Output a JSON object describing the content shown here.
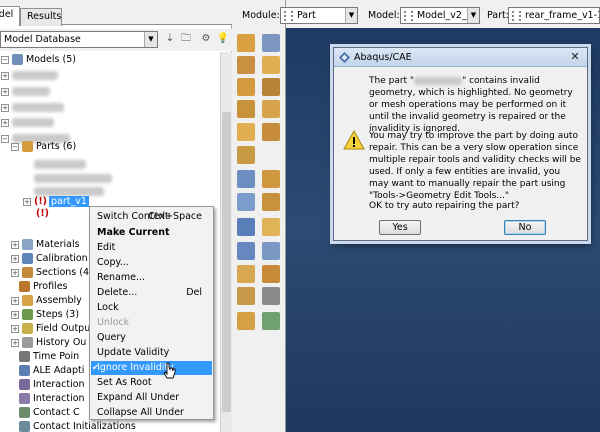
{
  "tabs": {
    "model": "odel",
    "results": "Results"
  },
  "db": {
    "label": "Model Database"
  },
  "tree": {
    "models": "Models (5)",
    "parts": "Parts (6)",
    "part_selected": "part_v1",
    "warn_mark": "(!)",
    "items": [
      {
        "label": "Materials"
      },
      {
        "label": "Calibration"
      },
      {
        "label": "Sections (4"
      },
      {
        "label": "Profiles"
      },
      {
        "label": "Assembly"
      },
      {
        "label": "Steps (3)"
      },
      {
        "label": "Field Outpu"
      },
      {
        "label": "History Ou"
      },
      {
        "label": "Time Poin"
      },
      {
        "label": "ALE Adapti"
      },
      {
        "label": "Interaction"
      },
      {
        "label": "Interaction"
      },
      {
        "label": "Contact C"
      },
      {
        "label": "Contact Initializations"
      }
    ]
  },
  "context": {
    "module_label": "Module:",
    "module_value": "Part",
    "model_label": "Model:",
    "model_value": "Model_v2_2",
    "part_label": "Part:",
    "part_value": "rear_frame_v1-1"
  },
  "dialog": {
    "title": "Abaqus/CAE",
    "close": "✕",
    "p1_a": "The part \"",
    "p1_b": "\" contains invalid geometry,",
    "p1_rest": "which is highlighted. No geometry or mesh operations may be performed on it until the invalid geometry is repaired or the invalidity is ignored.",
    "p2": "You may try to improve the part by doing auto repair. This can be a very slow operation since multiple repair tools and validity checks will be used. If only a few entities are invalid, you may want to manually repair the part using \"Tools->Geometry Edit Tools...\"",
    "p3": "OK to try auto repairing the part?",
    "yes": "Yes",
    "no": "No"
  },
  "menu": {
    "items": [
      {
        "label": "Switch Context",
        "accel": "Ctrl+Space"
      },
      {
        "label": "Make Current"
      },
      {
        "label": "Edit"
      },
      {
        "label": "Copy..."
      },
      {
        "label": "Rename..."
      },
      {
        "label": "Delete...",
        "accel": "Del"
      },
      {
        "label": "Lock"
      },
      {
        "label": "Unlock"
      },
      {
        "label": "Query"
      },
      {
        "label": "Update Validity"
      },
      {
        "label": "Ignore Invalidity",
        "check": "✔"
      },
      {
        "label": "Set As Root"
      },
      {
        "label": "Expand All Under"
      },
      {
        "label": "Collapse All Under"
      }
    ]
  },
  "colors": {
    "selection": "#3399ff",
    "viewport_top": "#1d3a62",
    "warn": "#c00000"
  }
}
